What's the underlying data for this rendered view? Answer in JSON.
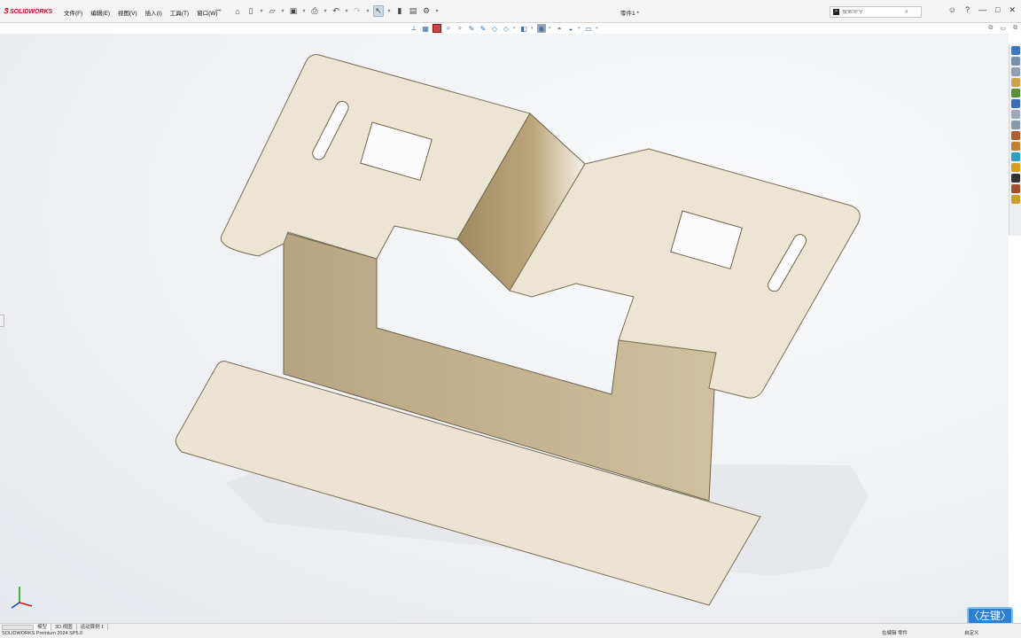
{
  "app": {
    "brand": "SOLIDWORKS",
    "doc_title": "零件1 *"
  },
  "menu": [
    "文件(F)",
    "编辑(E)",
    "视图(V)",
    "插入(I)",
    "工具(T)",
    "窗口(W)"
  ],
  "search": {
    "placeholder": "搜索命令"
  },
  "window_controls": [
    "?",
    "—",
    "□",
    "✕"
  ],
  "bottom_tabs": [
    "模型",
    "3D 视图",
    "运动算例 1"
  ],
  "status": {
    "product": "SOLIDWORKS Premium 2024 SP5.0",
    "mode": "在编辑 零件",
    "custom": "自定义"
  },
  "key_hint": "〈左键〉",
  "colors": {
    "accent": "#c8102e",
    "part": "#e9e2cf",
    "part_side": "#b9a887",
    "hint": "#2c7fd2"
  }
}
